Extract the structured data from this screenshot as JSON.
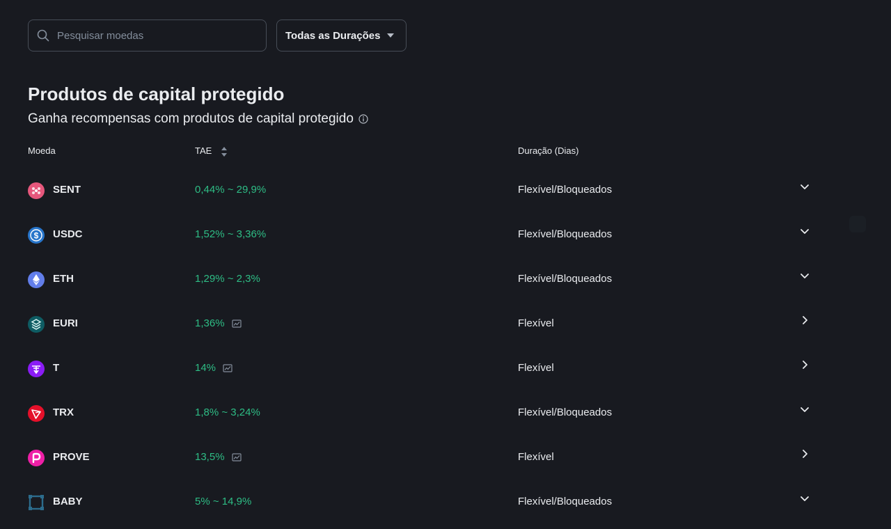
{
  "search": {
    "placeholder": "Pesquisar moedas",
    "icon": "search-icon"
  },
  "duration_filter": {
    "label": "Todas as Durações",
    "icon": "caret-down-icon"
  },
  "section": {
    "title": "Produtos de capital protegido",
    "subtitle": "Ganha recompensas com produtos de capital protegido"
  },
  "table": {
    "columns": {
      "coin": "Moeda",
      "apr": "TAE",
      "duration": "Duração (Dias)"
    },
    "rows": [
      {
        "coin": "SENT",
        "apr": "0,44% ~ 29,9%",
        "chart": false,
        "duration": "Flexível/Bloqueados",
        "expand": "chevron-down-icon",
        "color": "#e6577c"
      },
      {
        "coin": "USDC",
        "apr": "1,52% ~ 3,36%",
        "chart": false,
        "duration": "Flexível/Bloqueados",
        "expand": "chevron-down-icon",
        "color": "#2775ca"
      },
      {
        "coin": "ETH",
        "apr": "1,29% ~ 2,3%",
        "chart": false,
        "duration": "Flexível/Bloqueados",
        "expand": "chevron-down-icon",
        "color": "#627eea"
      },
      {
        "coin": "EURI",
        "apr": "1,36%",
        "chart": true,
        "duration": "Flexível",
        "expand": "chevron-right-icon",
        "color": "#0e5c63"
      },
      {
        "coin": "T",
        "apr": "14%",
        "chart": true,
        "duration": "Flexível",
        "expand": "chevron-right-icon",
        "color": "#8a1cf5"
      },
      {
        "coin": "TRX",
        "apr": "1,8% ~ 3,24%",
        "chart": false,
        "duration": "Flexível/Bloqueados",
        "expand": "chevron-down-icon",
        "color": "#e5102a"
      },
      {
        "coin": "PROVE",
        "apr": "13,5%",
        "chart": true,
        "duration": "Flexível",
        "expand": "chevron-right-icon",
        "color": "#ee1fa6"
      },
      {
        "coin": "BABY",
        "apr": "5% ~ 14,9%",
        "chart": false,
        "duration": "Flexível/Bloqueados",
        "expand": "chevron-down-icon",
        "color": "#2c6c8c"
      }
    ]
  },
  "colors": {
    "background": "#181a20",
    "text": "#eaecef",
    "muted": "#848e9c",
    "positive": "#2ebd85",
    "border": "#474d57"
  }
}
